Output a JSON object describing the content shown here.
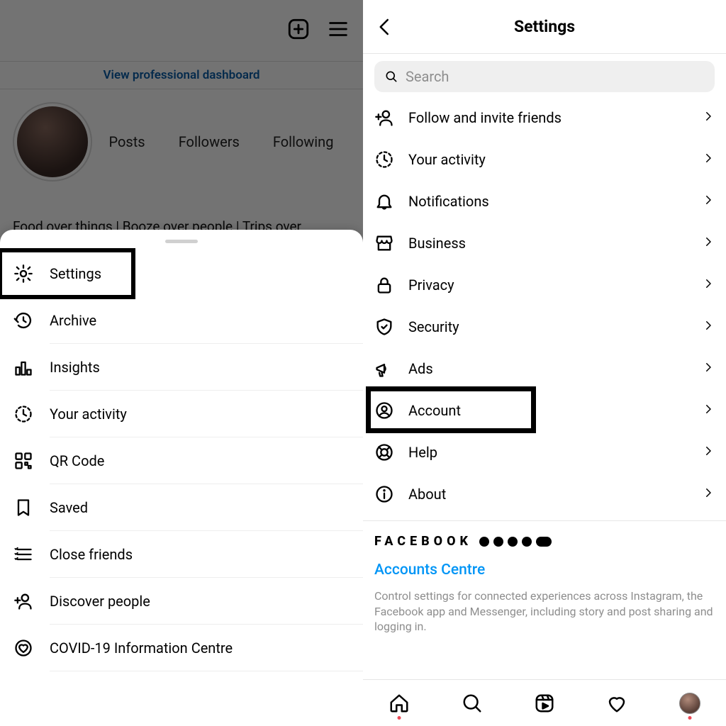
{
  "left": {
    "dashboard_link": "View professional dashboard",
    "stats": {
      "posts": "Posts",
      "followers": "Followers",
      "following": "Following"
    },
    "bio": "Food over things | Booze over people | Trips over",
    "menu": [
      {
        "key": "settings",
        "label": "Settings",
        "icon": "gear"
      },
      {
        "key": "archive",
        "label": "Archive",
        "icon": "archive"
      },
      {
        "key": "insights",
        "label": "Insights",
        "icon": "insights"
      },
      {
        "key": "activity",
        "label": "Your activity",
        "icon": "activity"
      },
      {
        "key": "qr",
        "label": "QR Code",
        "icon": "qr"
      },
      {
        "key": "saved",
        "label": "Saved",
        "icon": "bookmark"
      },
      {
        "key": "close-friends",
        "label": "Close friends",
        "icon": "close-friends"
      },
      {
        "key": "discover",
        "label": "Discover people",
        "icon": "add-person"
      },
      {
        "key": "covid",
        "label": "COVID-19 Information Centre",
        "icon": "heart-badge"
      }
    ]
  },
  "right": {
    "title": "Settings",
    "search_placeholder": "Search",
    "items": [
      {
        "key": "follow",
        "label": "Follow and invite friends",
        "icon": "add-person"
      },
      {
        "key": "activity",
        "label": "Your activity",
        "icon": "activity"
      },
      {
        "key": "notifications",
        "label": "Notifications",
        "icon": "bell"
      },
      {
        "key": "business",
        "label": "Business",
        "icon": "storefront"
      },
      {
        "key": "privacy",
        "label": "Privacy",
        "icon": "lock"
      },
      {
        "key": "security",
        "label": "Security",
        "icon": "shield"
      },
      {
        "key": "ads",
        "label": "Ads",
        "icon": "megaphone"
      },
      {
        "key": "account",
        "label": "Account",
        "icon": "user-circle"
      },
      {
        "key": "help",
        "label": "Help",
        "icon": "lifebuoy"
      },
      {
        "key": "about",
        "label": "About",
        "icon": "info"
      }
    ],
    "facebook_brand": "FACEBOOK",
    "accounts_centre": "Accounts Centre",
    "accounts_desc": "Control settings for connected experiences across Instagram, the Facebook app and Messenger, including story and post sharing and logging in."
  }
}
